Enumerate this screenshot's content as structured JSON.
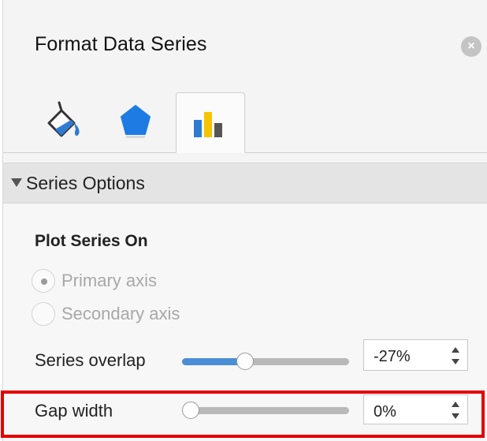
{
  "panel": {
    "title": "Format Data Series",
    "close_icon": "close-icon"
  },
  "tabs": [
    {
      "name": "fill-line",
      "icon": "paint-bucket-icon",
      "selected": false
    },
    {
      "name": "effects",
      "icon": "pentagon-icon",
      "selected": false
    },
    {
      "name": "series-options",
      "icon": "bar-chart-icon",
      "selected": true
    }
  ],
  "section": {
    "title": "Series Options",
    "expanded": true
  },
  "plot_series_on": {
    "heading": "Plot Series On",
    "options": [
      {
        "label": "Primary axis",
        "selected": true,
        "disabled": true
      },
      {
        "label": "Secondary axis",
        "selected": false,
        "disabled": true
      }
    ]
  },
  "series_overlap": {
    "label": "Series overlap",
    "value": "-27%",
    "slider_fraction": 0.365
  },
  "gap_width": {
    "label": "Gap width",
    "value": "0%",
    "slider_fraction": 0.0,
    "highlighted": true
  },
  "colors": {
    "accent_blue": "#4a8fd6",
    "highlight_red": "#e50000",
    "bar_yellow": "#f5c400",
    "bar_dark": "#555555"
  }
}
